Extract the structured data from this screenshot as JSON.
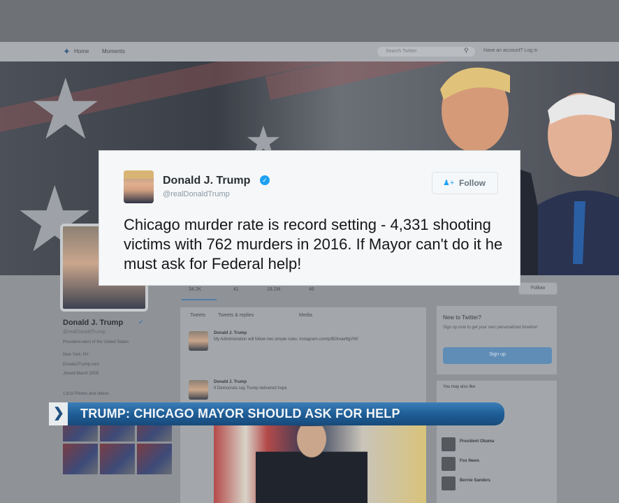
{
  "nav": {
    "home": "Home",
    "moments": "Moments",
    "search_placeholder": "Search Twitter",
    "login": "Have an account? Log in"
  },
  "profile": {
    "name": "Donald J. Trump",
    "handle": "@realDonaldTrump",
    "bio": "President-elect of the United States",
    "location": "New York, NY",
    "link": "DonaldJTrump.com",
    "joined": "Joined March 2009",
    "photos": "1,619 Photos and videos"
  },
  "stats": {
    "tweets": "34.2K",
    "following": "41",
    "followers": "18.2M",
    "likes": "46"
  },
  "follow_button_bg": "Follow",
  "timeline": {
    "tabs": [
      "Tweets",
      "Tweets & replies",
      "Media"
    ],
    "tweets": [
      {
        "name": "Donald J. Trump",
        "text": "My Administration will follow two simple rules: instagram.com/p/BOmaeftgVW/"
      },
      {
        "name": "Donald J. Trump",
        "text": "If Democrats say Trump delivered hope"
      }
    ]
  },
  "sidebar": {
    "wtf_title": "New to Twitter?",
    "wtf_text": "Sign up now to get your own personalized timeline!",
    "signup": "Sign up",
    "ymal_title": "You may also like",
    "ymal_people": [
      "President Obama",
      "Fox News",
      "Bernie Sanders"
    ]
  },
  "tweet_card": {
    "name": "Donald J. Trump",
    "handle": "@realDonaldTrump",
    "follow": "Follow",
    "text": "Chicago murder rate is record setting - 4,331 shooting victims with 762 murders in 2016. If Mayor can't do it he must ask for Federal help!"
  },
  "lower_third": {
    "headline": "TRUMP: CHICAGO MAYOR SHOULD ASK FOR HELP"
  },
  "colors": {
    "twitter_blue": "#1da1f2",
    "news_bar": "#1f5e97"
  }
}
